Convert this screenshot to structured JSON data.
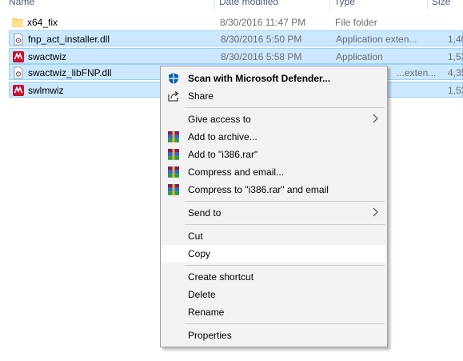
{
  "columns": {
    "name": "Name",
    "date": "Date modified",
    "type": "Type",
    "size": "Size"
  },
  "files": [
    {
      "name": "x64_fix",
      "date": "8/30/2016 11:47 PM",
      "type": "File folder",
      "size": "",
      "icon": "folder-icon",
      "selected": false
    },
    {
      "name": "fnp_act_installer.dll",
      "date": "8/30/2016 5:50 PM",
      "type": "Application exten...",
      "size": "1,40",
      "icon": "dll-file-icon",
      "selected": true
    },
    {
      "name": "swactwiz",
      "date": "8/30/2016 5:58 PM",
      "type": "Application",
      "size": "1,53",
      "icon": "app-icon",
      "selected": true
    },
    {
      "name": "swactwiz_libFNP.dll",
      "date": "",
      "type": "...exten...",
      "size": "4,35",
      "icon": "dll-file-icon",
      "selected": true
    },
    {
      "name": "swlmwiz",
      "date": "",
      "type": "",
      "size": "1,53",
      "icon": "app-icon",
      "selected": true
    }
  ],
  "context_menu": {
    "scan": "Scan with Microsoft Defender...",
    "share": "Share",
    "give_access": "Give access to",
    "add_archive": "Add to archive...",
    "add_rar": "Add to \"i386.rar\"",
    "compress_email": "Compress and email...",
    "compress_rar_email": "Compress to \"i386.rar\" and email",
    "send_to": "Send to",
    "cut": "Cut",
    "copy": "Copy",
    "create_shortcut": "Create shortcut",
    "delete": "Delete",
    "rename": "Rename",
    "properties": "Properties",
    "highlighted": "copy"
  },
  "colors": {
    "selection_bg": "#cce8ff",
    "selection_border": "#99d1ff",
    "menu_bg": "#f2f2f2",
    "menu_highlight": "#ffffff",
    "defender_blue": "#0063b1"
  }
}
